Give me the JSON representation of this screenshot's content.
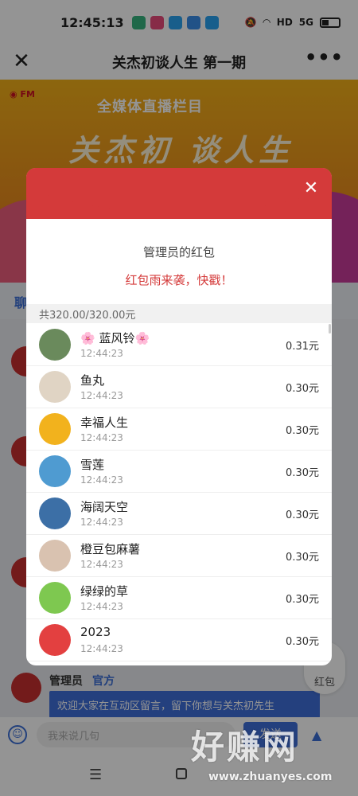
{
  "status": {
    "time": "12:45:13",
    "network": "5G",
    "hd": "HD"
  },
  "titlebar": {
    "title": "关杰初谈人生 第一期",
    "more": "•••"
  },
  "banner": {
    "subtitle": "全媒体直播栏目",
    "title": "关杰初 谈人生"
  },
  "chat": {
    "tab_label": "聊",
    "admin_name": "管理员",
    "admin_tag": "官方",
    "admin_message": "欢迎大家在互动区留言，留下你想与关杰初先生"
  },
  "input": {
    "placeholder": "我来说几句",
    "send_label": "发送"
  },
  "float_button": {
    "label": "红包"
  },
  "modal": {
    "sender": "管理员的红包",
    "wish": "红包雨来袭，快戳！",
    "total": "共320.00/320.00元",
    "recipients": [
      {
        "name": "🌸 蓝风铃🌸",
        "time": "12:44:23",
        "amount": "0.31元",
        "avatar_color": "#6a8a5c"
      },
      {
        "name": "鱼丸",
        "time": "12:44:23",
        "amount": "0.30元",
        "avatar_color": "#e0d4c4"
      },
      {
        "name": "幸福人生",
        "time": "12:44:23",
        "amount": "0.30元",
        "avatar_color": "#f2b21d"
      },
      {
        "name": "雪莲",
        "time": "12:44:23",
        "amount": "0.30元",
        "avatar_color": "#4f9bd1"
      },
      {
        "name": "海阔天空",
        "time": "12:44:23",
        "amount": "0.30元",
        "avatar_color": "#3c6fa6"
      },
      {
        "name": "橙豆包麻薯",
        "time": "12:44:23",
        "amount": "0.30元",
        "avatar_color": "#d9c2b0"
      },
      {
        "name": "绿绿的草",
        "time": "12:44:23",
        "amount": "0.30元",
        "avatar_color": "#7ec850"
      },
      {
        "name": "2023",
        "time": "12:44:23",
        "amount": "0.30元",
        "avatar_color": "#e34040"
      }
    ]
  },
  "watermark": {
    "text": "好赚网",
    "url": "www.zhuanyes.com"
  }
}
